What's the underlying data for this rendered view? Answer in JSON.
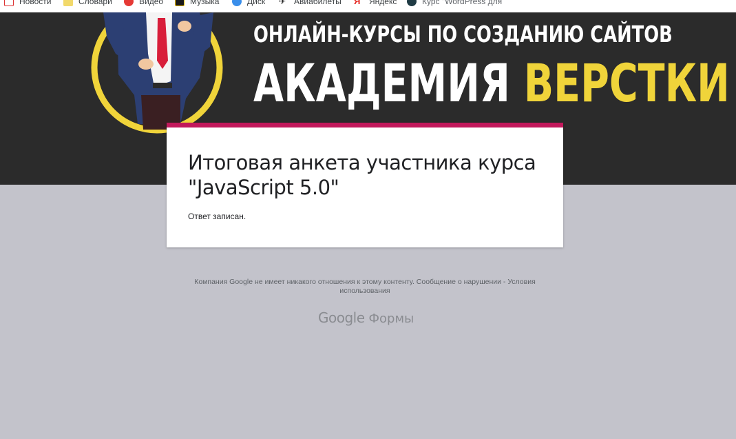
{
  "bookmarks": [
    {
      "label": "Новости",
      "icon": "news-icon"
    },
    {
      "label": "Словари",
      "icon": "dictionary-icon"
    },
    {
      "label": "Видео",
      "icon": "video-icon"
    },
    {
      "label": "Музыка",
      "icon": "music-icon"
    },
    {
      "label": "Диск",
      "icon": "disk-icon"
    },
    {
      "label": "Авиабилеты",
      "icon": "airplane-icon"
    },
    {
      "label": "Яндекс",
      "icon": "yandex-icon"
    },
    {
      "label": "Курс \"WordPress для",
      "icon": "course-icon"
    }
  ],
  "banner": {
    "line1": "ОНЛАЙН-КУРСЫ ПО СОЗДАНИЮ САЙТОВ",
    "line2_white": "АКАДЕМИЯ",
    "line2_yellow": "ВЕРСТКИ"
  },
  "form": {
    "title": "Итоговая анкета участника курса \"JavaScript 5.0\"",
    "message": "Ответ записан."
  },
  "footer": {
    "disclaimer": "Компания Google не имеет никакого отношения к этому контенту.",
    "report_link": "Сообщение о нарушении",
    "separator": "-",
    "terms_link": "Условия использования",
    "brand_google": "Google",
    "brand_forms": "Формы"
  },
  "colors": {
    "page_bg": "#c3c3cb",
    "banner_bg": "#2b2b2b",
    "accent": "#c2185b",
    "banner_yellow": "#f0d43a"
  }
}
